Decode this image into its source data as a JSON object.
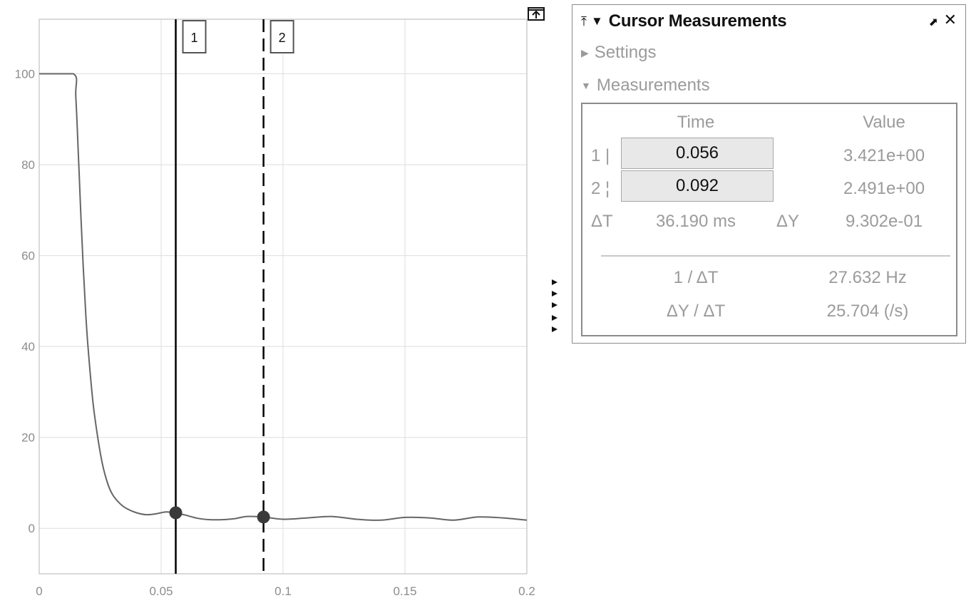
{
  "plot": {
    "x_ticks": [
      "0",
      "0.05",
      "0.1",
      "0.15",
      "0.2"
    ],
    "y_ticks": [
      "0",
      "20",
      "40",
      "60",
      "80",
      "100"
    ],
    "cursor_1_label": "1",
    "cursor_2_label": "2",
    "line_color": "#666666",
    "cursor_color": "#000000"
  },
  "chart_data": {
    "type": "line",
    "title": "",
    "xlabel": "",
    "ylabel": "",
    "xlim": [
      0,
      0.2
    ],
    "ylim": [
      -10,
      112
    ],
    "grid": true,
    "series": [
      {
        "x": [
          0,
          0.014,
          0.015,
          0.016,
          0.017,
          0.018,
          0.019,
          0.02,
          0.022,
          0.024,
          0.026,
          0.028,
          0.03,
          0.033,
          0.036,
          0.04,
          0.044,
          0.048,
          0.052,
          0.056,
          0.06,
          0.065,
          0.07,
          0.075,
          0.08,
          0.085,
          0.092,
          0.1,
          0.11,
          0.12,
          0.13,
          0.14,
          0.15,
          0.16,
          0.17,
          0.18,
          0.19,
          0.2
        ],
        "y": [
          100,
          100,
          95,
          83,
          70,
          58,
          48,
          40,
          28,
          20,
          14,
          10,
          7.5,
          5.5,
          4.3,
          3.4,
          3.0,
          3.2,
          3.6,
          3.4,
          2.9,
          2.2,
          1.9,
          1.9,
          2.1,
          2.6,
          2.5,
          2.0,
          2.3,
          2.6,
          2.0,
          1.8,
          2.4,
          2.3,
          1.8,
          2.5,
          2.3,
          1.8
        ]
      }
    ],
    "cursors": [
      {
        "label": "1",
        "x": 0.056,
        "y": 3.421,
        "style": "solid"
      },
      {
        "label": "2",
        "x": 0.092,
        "y": 2.491,
        "style": "dashed"
      }
    ]
  },
  "panel": {
    "title": "Cursor Measurements",
    "settings_label": "Settings",
    "measurements_label": "Measurements",
    "col_time": "Time",
    "col_value": "Value",
    "row1_label": "1 |",
    "row1_time": "0.056",
    "row1_value": "3.421e+00",
    "row2_label": "2 ¦",
    "row2_time": "0.092",
    "row2_value": "2.491e+00",
    "delta_t_label": "ΔT",
    "delta_t_value": "36.190 ms",
    "delta_y_label": "ΔY",
    "delta_y_value": "9.302e-01",
    "inv_dt_label": "1 / ΔT",
    "inv_dt_value": "27.632 Hz",
    "dy_dt_label": "ΔY / ΔT",
    "dy_dt_value": "25.704 (/s)"
  }
}
